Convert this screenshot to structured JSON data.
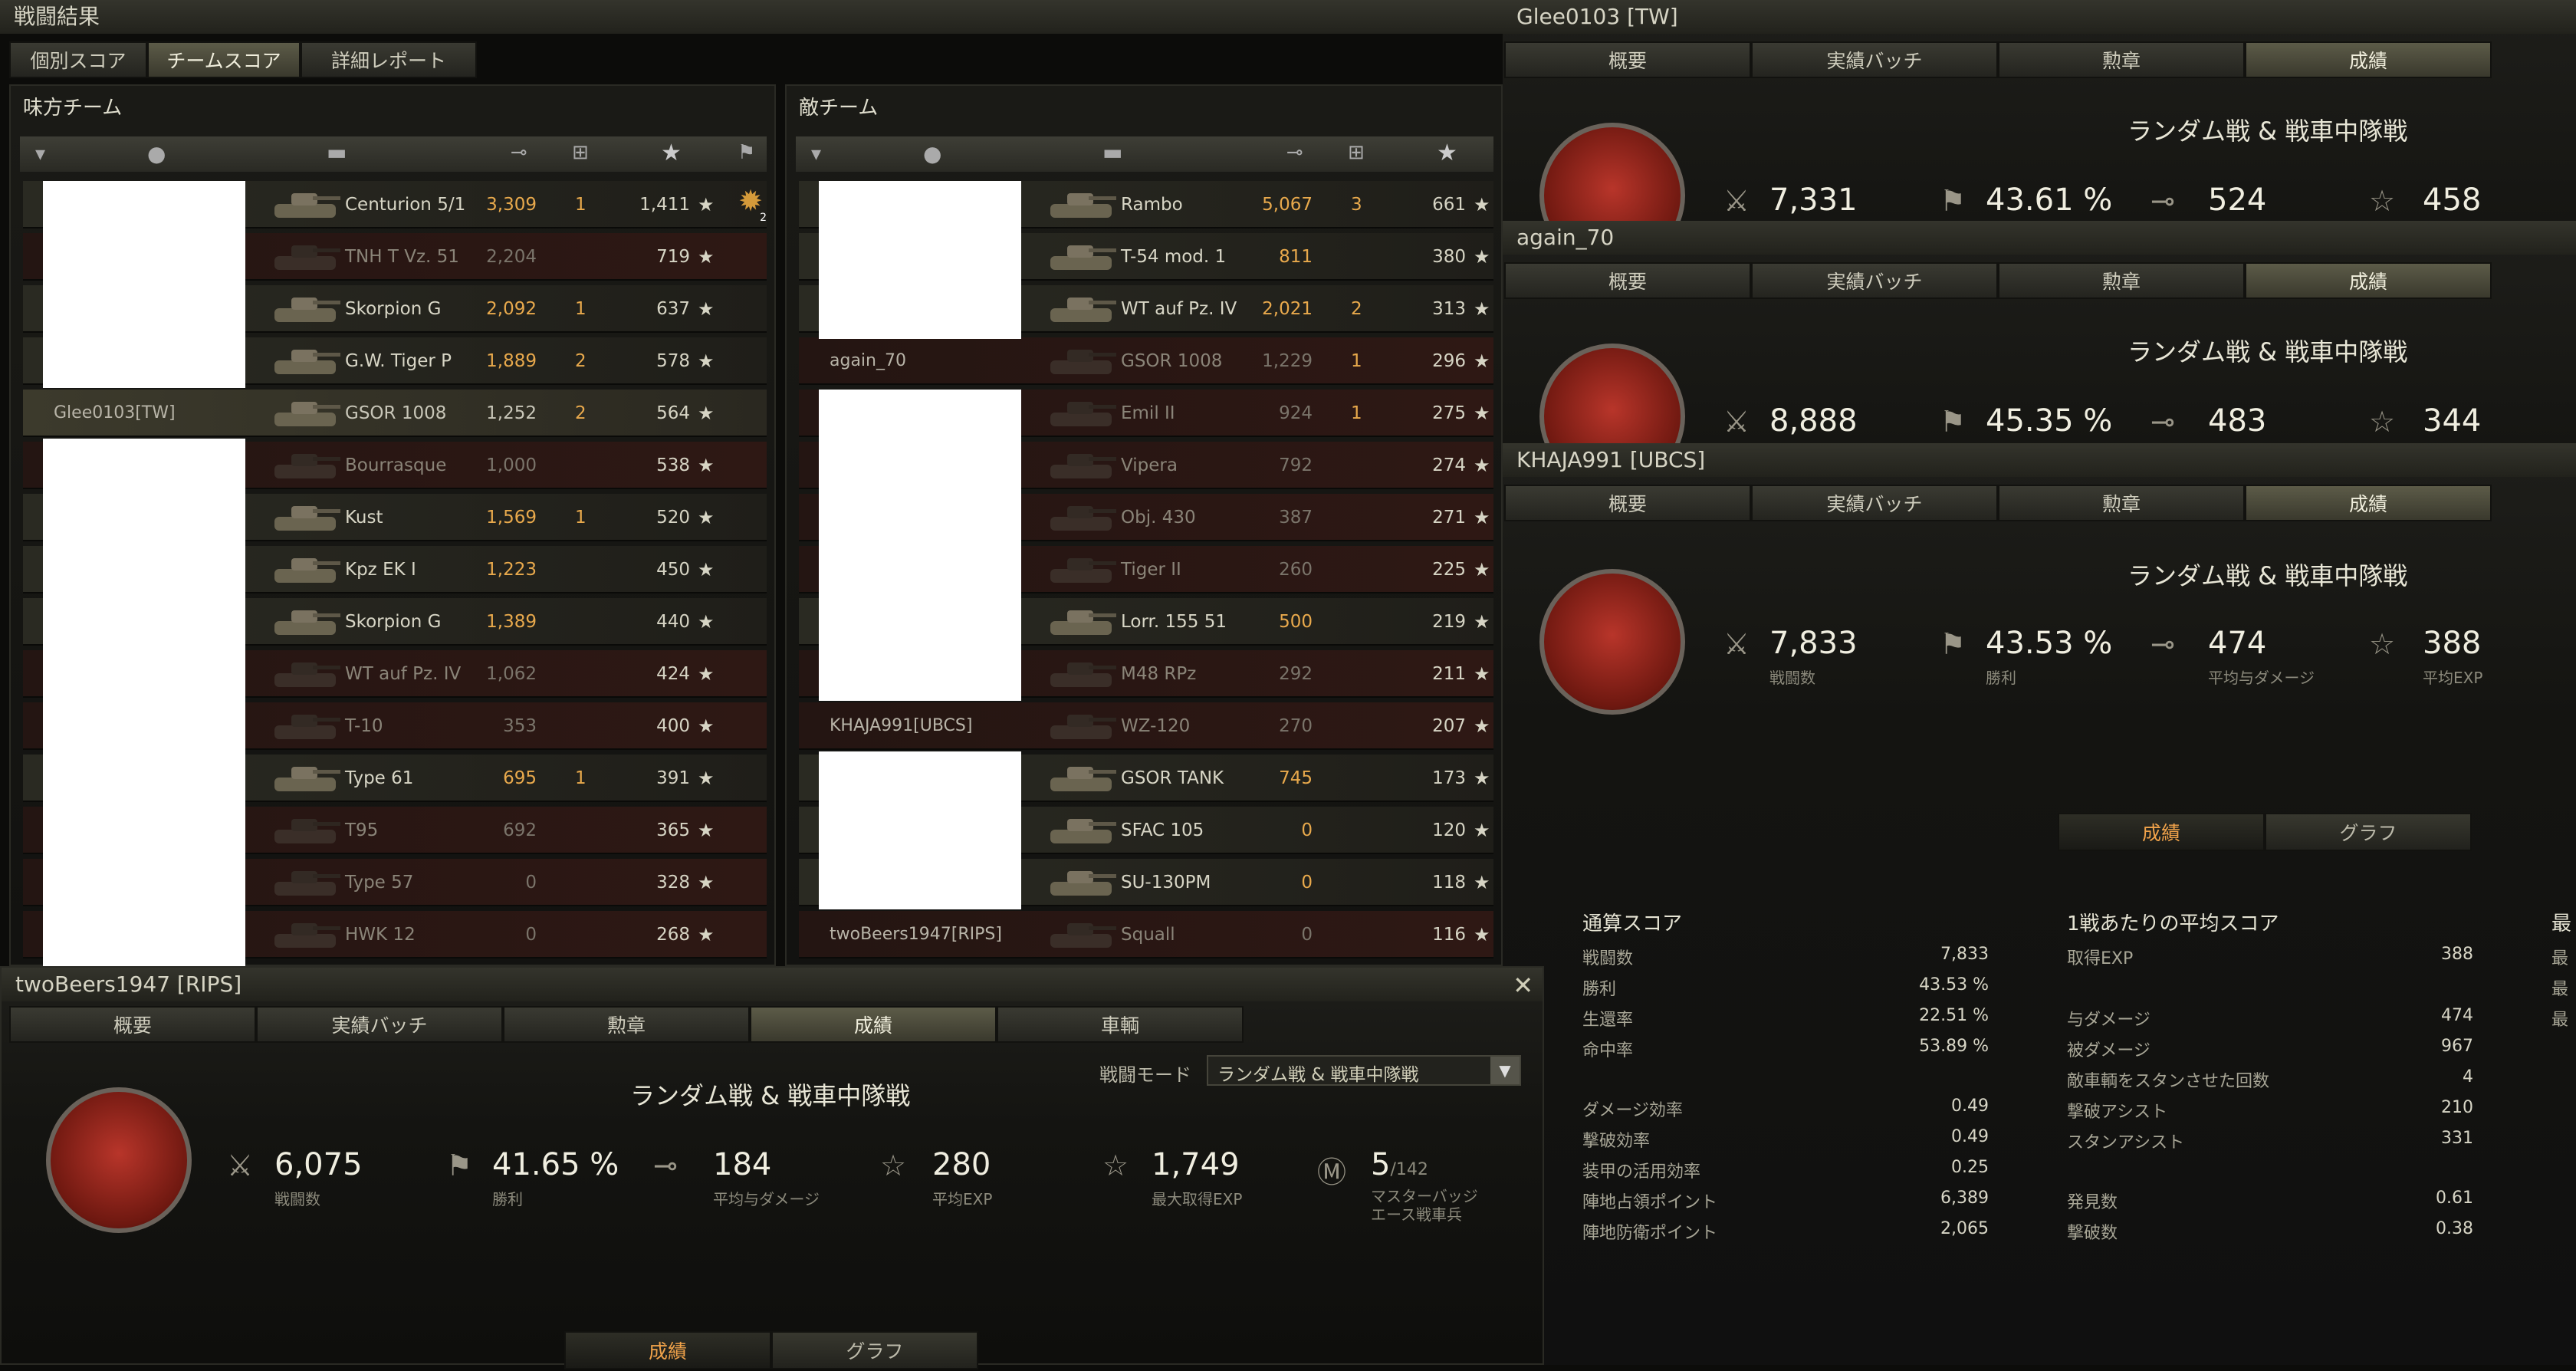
{
  "battle_results": {
    "title": "戦闘結果",
    "tabs": [
      "個別スコア",
      "チームスコア",
      "詳細レポート"
    ],
    "active_tab": 1,
    "ally_title": "味方チーム",
    "enemy_title": "敵チーム",
    "ally_rows": [
      {
        "player": "",
        "tank": "Centurion 5/1",
        "damage": "3,309",
        "kills": "1",
        "xp": "1,411",
        "status": "alive",
        "medal": "2"
      },
      {
        "player": "",
        "tank": "TNH T Vz. 51",
        "damage": "2,204",
        "kills": "",
        "xp": "719",
        "status": "dead"
      },
      {
        "player": "",
        "tank": "Skorpion G",
        "damage": "2,092",
        "kills": "1",
        "xp": "637",
        "status": "alive"
      },
      {
        "player": "",
        "tank": "G.W. Tiger P",
        "damage": "1,889",
        "kills": "2",
        "xp": "578",
        "status": "alive"
      },
      {
        "player": "Glee0103[TW]",
        "tank": "GSOR 1008",
        "damage": "1,252",
        "kills": "2",
        "xp": "564",
        "status": "me"
      },
      {
        "player": "",
        "tank": "Bourrasque",
        "damage": "1,000",
        "kills": "",
        "xp": "538",
        "status": "dead"
      },
      {
        "player": "",
        "tank": "Kust",
        "damage": "1,569",
        "kills": "1",
        "xp": "520",
        "status": "alive"
      },
      {
        "player": "",
        "tank": "Kpz EK I",
        "damage": "1,223",
        "kills": "",
        "xp": "450",
        "status": "alive"
      },
      {
        "player": "",
        "tank": "Skorpion G",
        "damage": "1,389",
        "kills": "",
        "xp": "440",
        "status": "alive"
      },
      {
        "player": "",
        "tank": "WT auf Pz. IV",
        "damage": "1,062",
        "kills": "",
        "xp": "424",
        "status": "dead"
      },
      {
        "player": "",
        "tank": "T-10",
        "damage": "353",
        "kills": "",
        "xp": "400",
        "status": "dead"
      },
      {
        "player": "",
        "tank": "Type 61",
        "damage": "695",
        "kills": "1",
        "xp": "391",
        "status": "alive"
      },
      {
        "player": "",
        "tank": "T95",
        "damage": "692",
        "kills": "",
        "xp": "365",
        "status": "dead"
      },
      {
        "player": "",
        "tank": "Type 57",
        "damage": "0",
        "kills": "",
        "xp": "328",
        "status": "dead"
      },
      {
        "player": "",
        "tank": "HWK 12",
        "damage": "0",
        "kills": "",
        "xp": "268",
        "status": "dead"
      }
    ],
    "enemy_rows": [
      {
        "player": "",
        "tank": "Rambo",
        "damage": "5,067",
        "kills": "3",
        "xp": "661",
        "status": "alive"
      },
      {
        "player": "",
        "tank": "T-54 mod. 1",
        "damage": "811",
        "kills": "",
        "xp": "380",
        "status": "alive"
      },
      {
        "player": "",
        "tank": "WT auf Pz. IV",
        "damage": "2,021",
        "kills": "2",
        "xp": "313",
        "status": "alive"
      },
      {
        "player": "again_70",
        "tank": "GSOR 1008",
        "damage": "1,229",
        "kills": "1",
        "xp": "296",
        "status": "dead"
      },
      {
        "player": "",
        "tank": "Emil II",
        "damage": "924",
        "kills": "1",
        "xp": "275",
        "status": "dead"
      },
      {
        "player": "",
        "tank": "Vipera",
        "damage": "792",
        "kills": "",
        "xp": "274",
        "status": "dead"
      },
      {
        "player": "",
        "tank": "Obj. 430",
        "damage": "387",
        "kills": "",
        "xp": "271",
        "status": "dead"
      },
      {
        "player": "",
        "tank": "Tiger II",
        "damage": "260",
        "kills": "",
        "xp": "225",
        "status": "dead"
      },
      {
        "player": "",
        "tank": "Lorr. 155 51",
        "damage": "500",
        "kills": "",
        "xp": "219",
        "status": "alive"
      },
      {
        "player": "",
        "tank": "M48 RPz",
        "damage": "292",
        "kills": "",
        "xp": "211",
        "status": "dead"
      },
      {
        "player": "KHAJA991[UBCS]",
        "tank": "WZ-120",
        "damage": "270",
        "kills": "",
        "xp": "207",
        "status": "dead"
      },
      {
        "player": "",
        "tank": "GSOR TANK",
        "damage": "745",
        "kills": "",
        "xp": "173",
        "status": "alive"
      },
      {
        "player": "",
        "tank": "SFAC 105",
        "damage": "0",
        "kills": "",
        "xp": "120",
        "status": "alive"
      },
      {
        "player": "",
        "tank": "SU-130PM",
        "damage": "0",
        "kills": "",
        "xp": "118",
        "status": "alive"
      },
      {
        "player": "twoBeers1947[RIPS]",
        "tank": "Squall",
        "damage": "0",
        "kills": "",
        "xp": "116",
        "status": "dead"
      }
    ]
  },
  "profile_tabs": [
    "概要",
    "実績バッチ",
    "勲章",
    "成績",
    "車輌"
  ],
  "mode_name": "ランダム戦 & 戦車中隊戦",
  "stat_labels": {
    "battles": "戦闘数",
    "winrate": "勝利",
    "avg_damage": "平均与ダメージ",
    "avg_xp": "平均EXP",
    "max_xp": "最大取得EXP",
    "mastery": "マスターバッジ\nエース戦車兵"
  },
  "profiles": [
    {
      "name": "Glee0103 [TW]",
      "battles": "7,331",
      "winrate": "43.61 %",
      "avg_damage": "524",
      "avg_xp": "458"
    },
    {
      "name": "again_70",
      "battles": "8,888",
      "winrate": "45.35 %",
      "avg_damage": "483",
      "avg_xp": "344"
    },
    {
      "name": "KHAJA991 [UBCS]",
      "battles": "7,833",
      "winrate": "43.53 %",
      "avg_damage": "474",
      "avg_xp": "388"
    }
  ],
  "khaja_detail": {
    "subtabs": [
      "成績",
      "グラフ"
    ],
    "overall_title": "通算スコア",
    "overall": [
      {
        "k": "戦闘数",
        "v": "7,833"
      },
      {
        "k": "勝利",
        "v": "43.53 %"
      },
      {
        "k": "生還率",
        "v": "22.51 %"
      },
      {
        "k": "命中率",
        "v": "53.89 %"
      },
      {
        "k": "ダメージ効率",
        "v": "0.49"
      },
      {
        "k": "撃破効率",
        "v": "0.49"
      },
      {
        "k": "装甲の活用効率",
        "v": "0.25"
      },
      {
        "k": "陣地占領ポイント",
        "v": "6,389"
      },
      {
        "k": "陣地防衛ポイント",
        "v": "2,065"
      }
    ],
    "avg_title": "1戦あたりの平均スコア",
    "avg": [
      {
        "k": "取得EXP",
        "v": "388"
      },
      {
        "k": "与ダメージ",
        "v": "474"
      },
      {
        "k": "被ダメージ",
        "v": "967"
      },
      {
        "k": "敵車輌をスタンさせた回数",
        "v": "4"
      },
      {
        "k": "撃破アシスト",
        "v": "210"
      },
      {
        "k": "スタンアシスト",
        "v": "331"
      },
      {
        "k": "発見数",
        "v": "0.61"
      },
      {
        "k": "撃破数",
        "v": "0.38"
      }
    ],
    "cut_title": "最",
    "cut_items": [
      "最",
      "最",
      "最"
    ]
  },
  "twobeers": {
    "name": "twoBeers1947 [RIPS]",
    "close": "✕",
    "battle_mode_label": "戦闘モード",
    "battle_mode_value": "ランダム戦 & 戦車中隊戦",
    "battles": "6,075",
    "winrate": "41.65 %",
    "avg_damage": "184",
    "avg_xp": "280",
    "max_xp": "1,749",
    "mastery": "5",
    "mastery_total": "/142",
    "subtabs": [
      "成績",
      "グラフ"
    ]
  },
  "icons": {
    "battles": "crossed-swords-icon",
    "winrate": "flag-icon",
    "damage": "shell-icon",
    "xp": "star-icon",
    "mastery": "mastery-badge-icon"
  }
}
